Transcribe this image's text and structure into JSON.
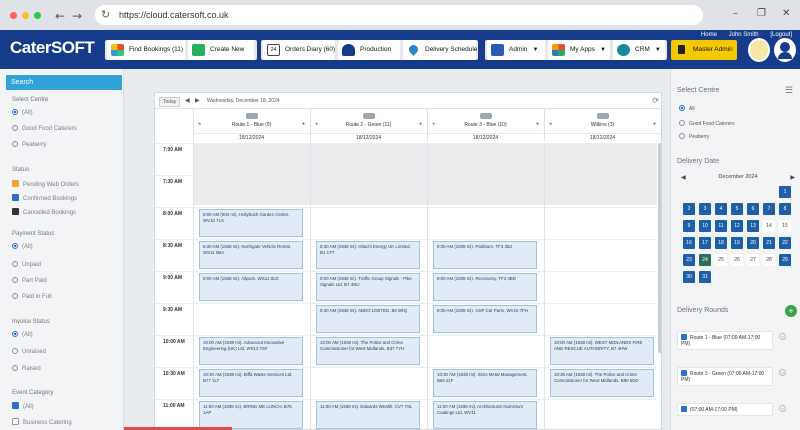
{
  "browser": {
    "url": "https://cloud.catersoft.co.uk"
  },
  "app": {
    "logo": "CaterSOFT",
    "top_links": [
      "Home",
      "John Smith",
      "[Logout]"
    ],
    "toolbar": {
      "find_bookings": "Find Bookings (11)",
      "create_new": "Create New",
      "orders_diary": "Orders Diary (60)",
      "production": "Production",
      "delivery_schedule": "Delivery Schedule",
      "admin": "Admin",
      "my_apps": "My Apps",
      "crm": "CRM",
      "master_admin": "Master Admin",
      "diary_icon_num": "24"
    }
  },
  "left": {
    "search": "Search",
    "select_centre": {
      "title": "Select Centre",
      "options": [
        "(All)",
        "Good Food Caterers",
        "Peaberry"
      ]
    },
    "status": {
      "title": "Status",
      "items": [
        "Pending Web Orders",
        "Confirmed Bookings",
        "Cancelled Bookings"
      ]
    },
    "payment_status": {
      "title": "Payment Status",
      "options": [
        "(All)",
        "Unpaid",
        "Part Paid",
        "Paid in Full"
      ]
    },
    "invoice_status": {
      "title": "Invoice Status",
      "options": [
        "(All)",
        "Unraised",
        "Raised"
      ]
    },
    "event_category": {
      "title": "Event Category",
      "options": [
        "(All)",
        "Business Catering"
      ]
    },
    "colors": {
      "pending": "#f2a23a",
      "confirmed": "#2d6fd0",
      "cancelled": "#333333"
    }
  },
  "calendar": {
    "today": "Today",
    "date_label": "Wednesday, December 18, 2024",
    "columns": [
      {
        "name": "Route 1 - Blue (9)",
        "date": "18/12/2024"
      },
      {
        "name": "Route 2 - Green (11)",
        "date": "18/12/2024"
      },
      {
        "name": "Route 3 - Blue (10)",
        "date": "18/12/2024"
      },
      {
        "name": "Wilkins (3)",
        "date": "18/12/2024"
      }
    ],
    "times": [
      "7:00 AM",
      "7:30 AM",
      "8:00 AM",
      "8:30 AM",
      "9:00 AM",
      "9:30 AM",
      "10:00 AM",
      "10:30 AM",
      "11:00 AM"
    ],
    "events": [
      {
        "col": 0,
        "slot": 2,
        "text": "8:00 AM (000 mi). Hollybush Garden Centre, WV10 7LX"
      },
      {
        "col": 0,
        "slot": 3,
        "text": "8:30 AM (1938 mi). Northgate Vehicle Rental, WS11 0BA"
      },
      {
        "col": 0,
        "slot": 4,
        "text": "9:00 AM (1938 mi). Allpack, WS11 8LD"
      },
      {
        "col": 0,
        "slot": 6,
        "text": "10:00 AM (1938 mi). Advanced Innovative Engineering (UK) Ltd, WS13 7SF"
      },
      {
        "col": 0,
        "slot": 7,
        "text": "10:30 AM (1938 mi). Biffa Waste Services Ltd, B77 1LT"
      },
      {
        "col": 0,
        "slot": 8,
        "text": "11:00 AM (1938 mi). BRING ME LUNCH, B76 1AP"
      },
      {
        "col": 1,
        "slot": 3,
        "text": "8:30 AM (1938 mi). Hitachi Energy UK Limited, B1 1TT"
      },
      {
        "col": 1,
        "slot": 4,
        "text": "9:00 AM (1938 mi). Traffic Group Signals - Pike Signals Ltd, B7 4NU"
      },
      {
        "col": 1,
        "slot": 5,
        "text": "9:30 AM (1938 mi). ABDO LIMITED, B6 5RQ"
      },
      {
        "col": 1,
        "slot": 6,
        "text": "10:00 AM (1938 mi). The Police and Crime Commissioner for West Midlands, B37 7YH"
      },
      {
        "col": 1,
        "slot": 8,
        "text": "11:00 AM (1938 mi). Edwards Wealth, CV7 7SL"
      },
      {
        "col": 2,
        "slot": 3,
        "text": "8:30 AM (1938 mi). Parkburn, TF3 3BJ"
      },
      {
        "col": 2,
        "slot": 4,
        "text": "9:00 AM (1938 mi). Reconomy, TF3 3BD"
      },
      {
        "col": 2,
        "slot": 5,
        "text": "9:30 AM (1938 mi). GSF Car Parts, WV10 7FH"
      },
      {
        "col": 2,
        "slot": 7,
        "text": "10:30 AM (1938 mi). Sims Metal Management, B66 2LF"
      },
      {
        "col": 2,
        "slot": 8,
        "text": "11:00 AM (1938 mi). Architectural Aluminium Coatings Ltd, WV11"
      },
      {
        "col": 3,
        "slot": 6,
        "text": "10:00 AM (1938 mi). WEST MIDLANDS FIRE AND RESCUE AUTHORITY, B7 4HW"
      },
      {
        "col": 3,
        "slot": 7,
        "text": "10:30 AM (1938 mi). The Police and Crime Commissioner for West Midlands, B90 5DD"
      }
    ]
  },
  "right": {
    "select_centre": {
      "title": "Select Centre",
      "options": [
        "All",
        "Good Food Caterers",
        "Peaberry"
      ]
    },
    "delivery_date": {
      "title": "Delivery Date",
      "month": "December 2024",
      "weekday_headers": [
        "",
        "",
        "",
        "",
        "",
        "",
        ""
      ]
    },
    "days": [
      "1",
      "2",
      "3",
      "4",
      "5",
      "6",
      "7",
      "8",
      "9",
      "10",
      "11",
      "12",
      "13",
      "14",
      "15",
      "16",
      "17",
      "18",
      "19",
      "20",
      "21",
      "22",
      "23",
      "24",
      "25",
      "26",
      "27",
      "28",
      "29",
      "30",
      "31"
    ],
    "delivery_rounds": {
      "title": "Delivery Rounds",
      "items": [
        "Route 1 - Blue (07:00 AM-17:00 PM)",
        "Route 3 - Green (07:00 AM-17:00 PM)",
        "(07:00 AM-17:00 PM)"
      ]
    }
  }
}
